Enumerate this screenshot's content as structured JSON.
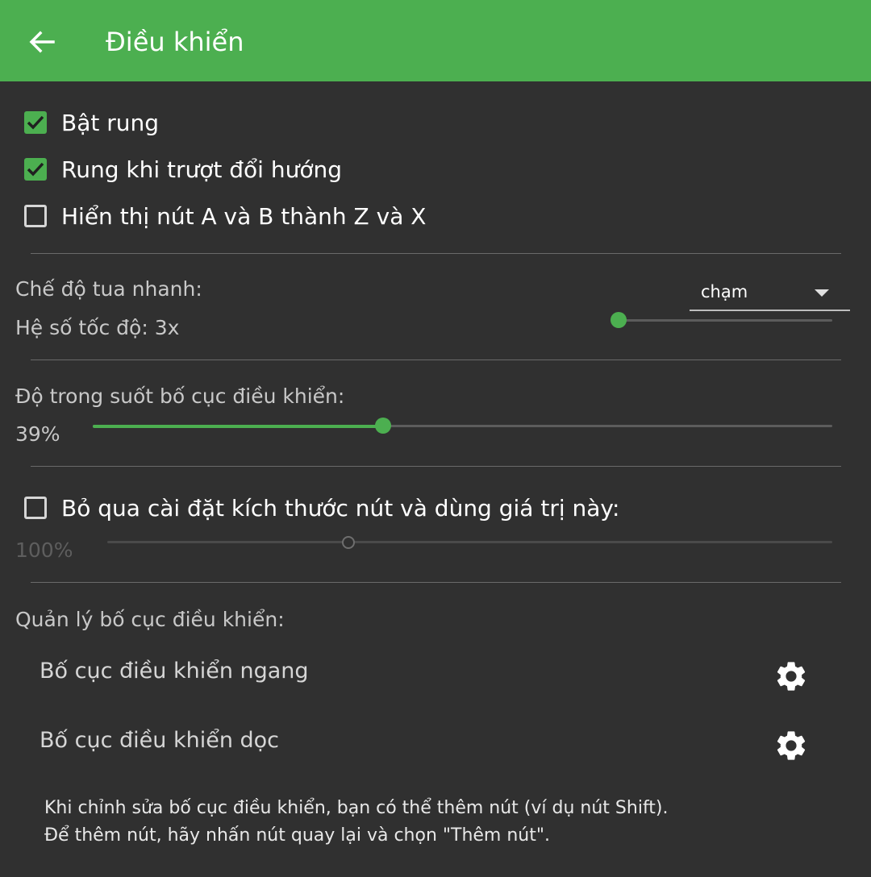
{
  "appbar": {
    "title": "Điều khiển",
    "back_icon": "arrow-left-icon",
    "color": "#4caf50"
  },
  "checkboxes": [
    {
      "label": "Bật rung",
      "checked": true
    },
    {
      "label": "Rung khi trượt đổi hướng",
      "checked": true
    },
    {
      "label": "Hiển thị nút A và B thành Z và X",
      "checked": false
    }
  ],
  "fast_forward": {
    "mode_label": "Chế độ tua nhanh:",
    "mode_value": "chạm",
    "speed_label": "Hệ số tốc độ: 3x",
    "speed_slider_fraction": 0.0
  },
  "opacity": {
    "label": "Độ trong suốt bố cục điều khiển:",
    "value_text": "39%",
    "value": 39
  },
  "button_size": {
    "label": "Bỏ qua cài đặt kích thước nút và dùng giá trị này:",
    "checked": false,
    "value_text": "100%",
    "slider_fraction": 0.33,
    "enabled": false
  },
  "layout_management": {
    "heading": "Quản lý bố cục điều khiển:",
    "items": [
      {
        "label": "Bố cục điều khiển ngang",
        "icon": "gear-icon"
      },
      {
        "label": "Bố cục điều khiển dọc",
        "icon": "gear-icon"
      }
    ],
    "note_line1": "Khi chỉnh sửa bố cục điều khiển, bạn có thể thêm nút (ví dụ nút Shift).",
    "note_line2": "Để thêm nút, hãy nhấn nút quay lại và chọn \"Thêm nút\"."
  },
  "colors": {
    "accent": "#4caf50",
    "background": "#303030"
  }
}
